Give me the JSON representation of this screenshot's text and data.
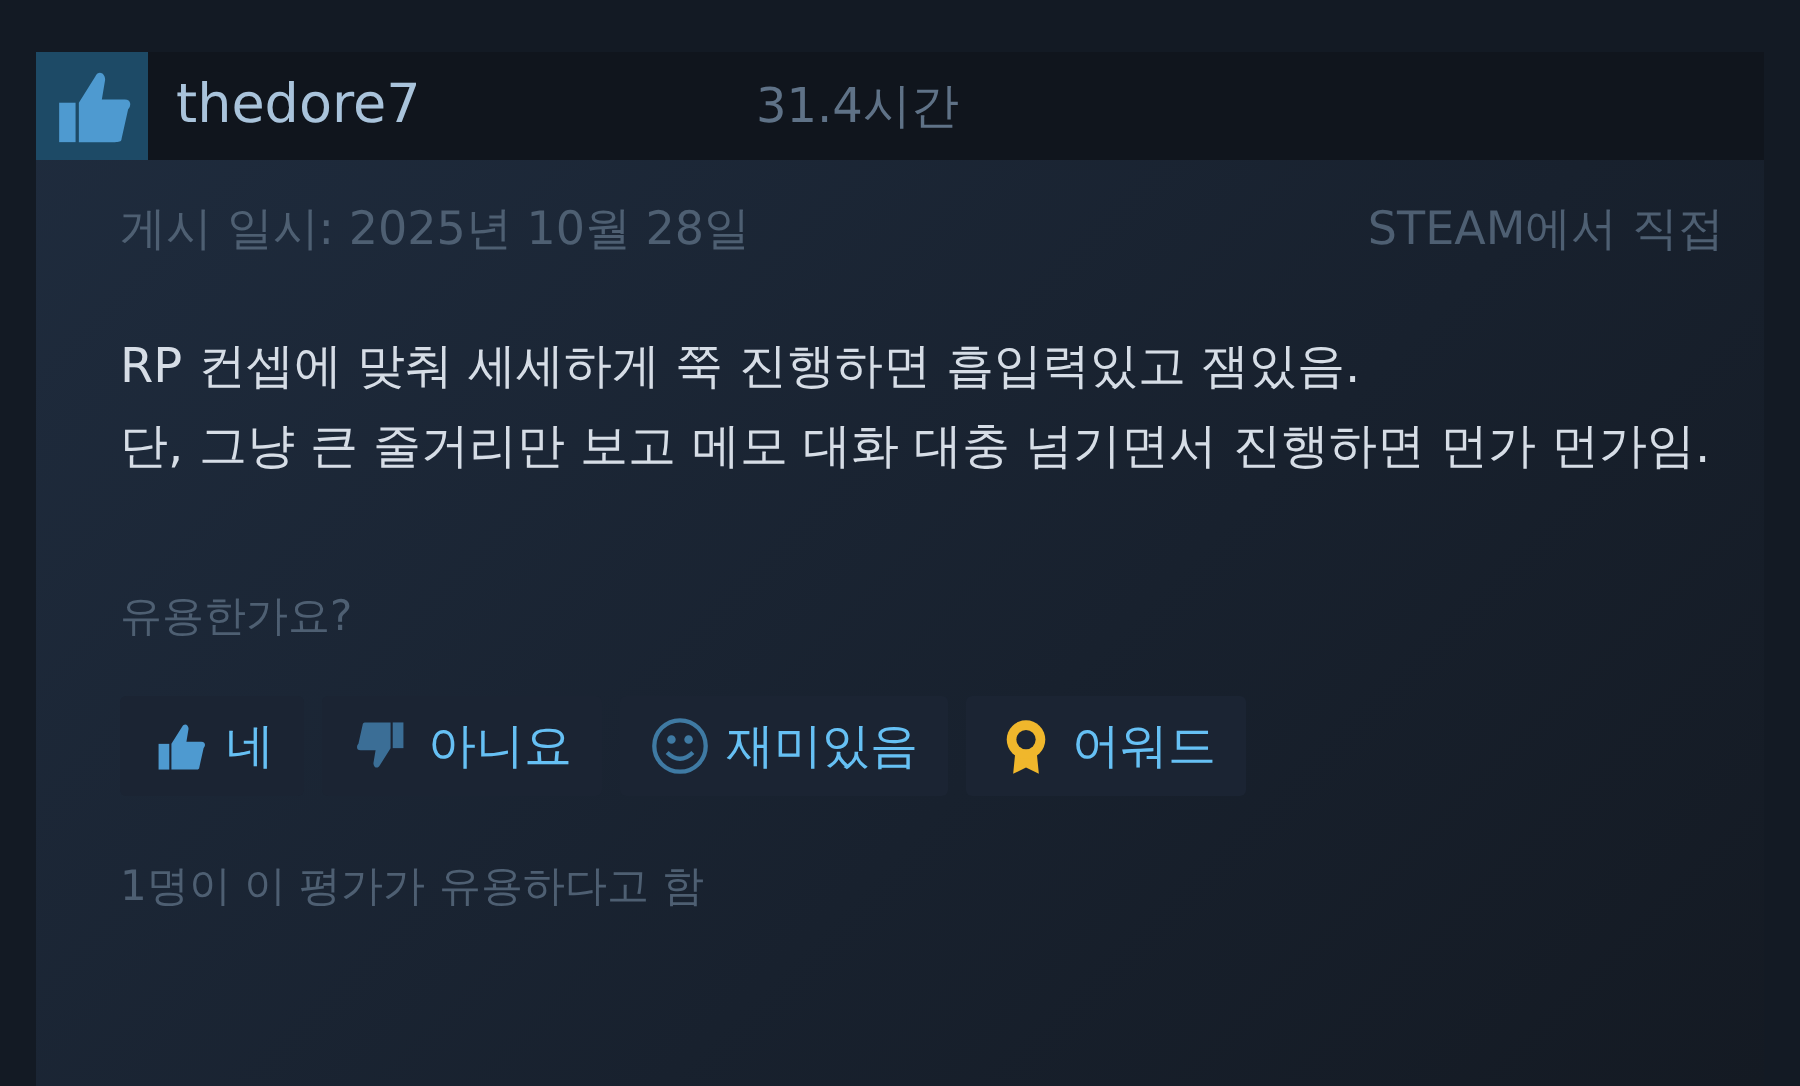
{
  "review": {
    "recommended": true,
    "author": "thedore7",
    "hours": "31.4시간",
    "posted": "게시 일시: 2025년 10월 28일",
    "source": "STEAM에서 직접",
    "body": [
      "RP 컨셉에 맞춰 세세하게 쭉 진행하면 흡입력있고 잼있음.",
      "단, 그냥 큰 줄거리만 보고 메모 대화 대충 넘기면서 진행하면 먼가 먼가임."
    ],
    "question": "유용한가요?",
    "buttons": [
      {
        "kind": "thumb-up",
        "label": "네"
      },
      {
        "kind": "thumb-down",
        "label": "아니요"
      },
      {
        "kind": "smile",
        "label": "재미있음"
      },
      {
        "kind": "award",
        "label": "어워드"
      }
    ],
    "helpful_count": "1명이 이 평가가 유용하다고 함"
  }
}
